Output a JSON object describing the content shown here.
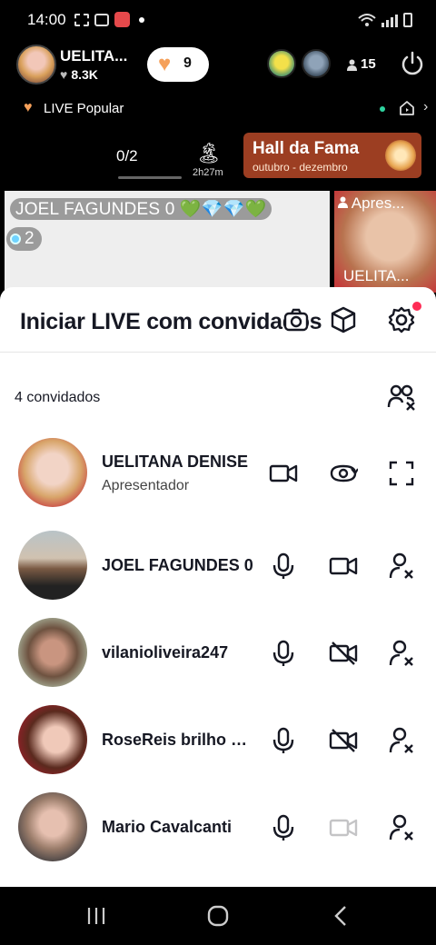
{
  "status_bar": {
    "time": "14:00"
  },
  "live_header": {
    "host_name": "UELITA...",
    "host_likes": "8.3K",
    "gift_count": "9",
    "viewer_count": "15",
    "popular_label": "LIVE Popular",
    "counter": "0/2",
    "island_time": "2h27m",
    "hall_title": "Hall da Fama",
    "hall_period": "outubro - dezembro"
  },
  "video": {
    "left_name": "JOEL FAGUNDES 0 💚💎💎💚",
    "left_badge": "2",
    "right_tag": "Apres...",
    "right_name": "UELITA..."
  },
  "sheet": {
    "title": "Iniciar LIVE com convidados",
    "guests_count": "4 convidados",
    "guests": [
      {
        "name": "UELITANA DENISE",
        "role": "Apresentador",
        "icons": [
          "video-camera-icon",
          "flip-camera-icon",
          "fullscreen-icon"
        ]
      },
      {
        "name": "JOEL FAGUNDES 0",
        "icons": [
          "microphone-icon",
          "video-camera-icon",
          "remove-guest-icon"
        ]
      },
      {
        "name": "vilanioliveira247",
        "icons": [
          "microphone-icon",
          "video-camera-off-icon",
          "remove-guest-icon"
        ]
      },
      {
        "name": "RoseReis brilho de luz",
        "icons": [
          "microphone-icon",
          "video-camera-off-icon",
          "remove-guest-icon"
        ]
      },
      {
        "name": "Mario Cavalcanti",
        "icons": [
          "microphone-icon",
          "video-camera-disabled-icon",
          "remove-guest-icon"
        ]
      }
    ]
  },
  "colors": {
    "accent": "#fe2c55",
    "hall_bg": "#9c3e22",
    "heart": "#f5a05a"
  }
}
